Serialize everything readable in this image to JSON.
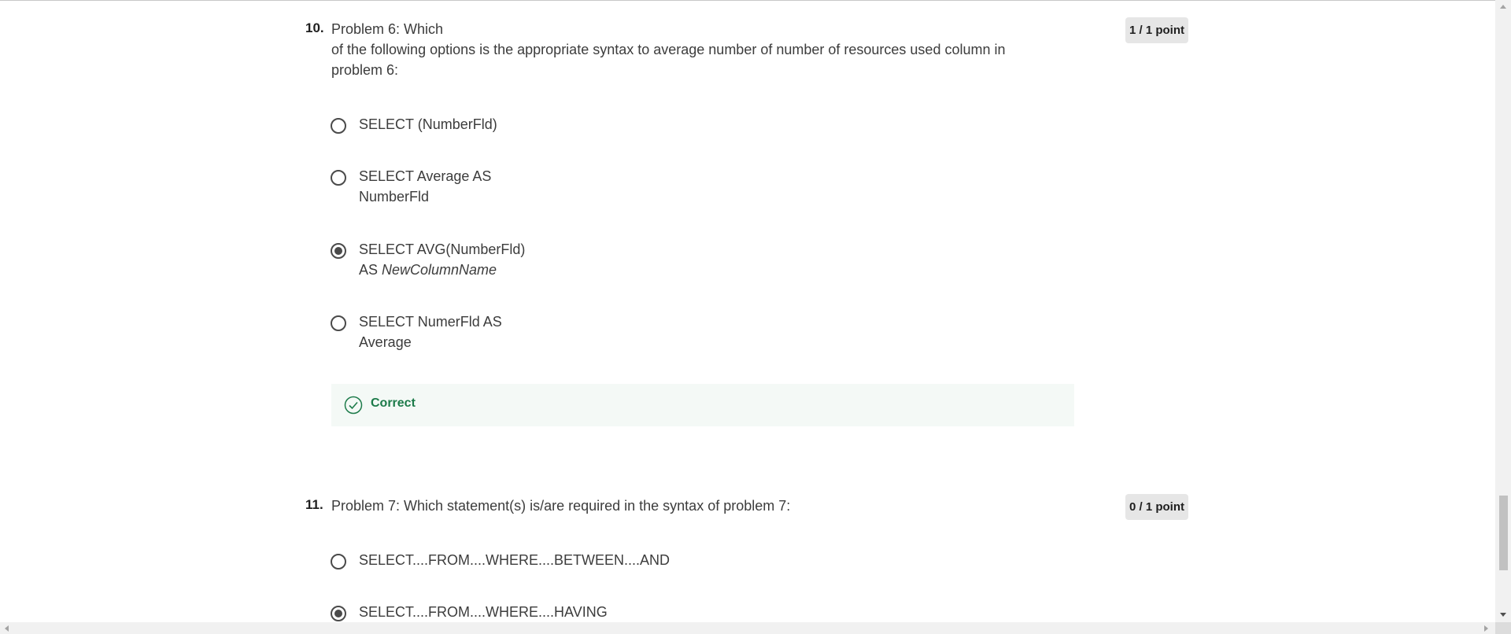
{
  "questions": [
    {
      "number": "10.",
      "text_lines": [
        "Problem 6: Which",
        "of the following options is the appropriate syntax to average number of number of resources used column in",
        "problem 6:"
      ],
      "points": "1 / 1 point",
      "options": [
        {
          "lines": [
            "SELECT (NumberFld)"
          ],
          "selected": false
        },
        {
          "lines": [
            "SELECT Average AS",
            "NumberFld"
          ],
          "selected": false
        },
        {
          "line1": "SELECT AVG(NumberFld)",
          "line2_prefix": "AS ",
          "line2_em": "NewColumnName",
          "selected": true
        },
        {
          "lines": [
            "SELECT NumerFld AS",
            "Average"
          ],
          "selected": false
        }
      ],
      "feedback": {
        "icon": "check-circle-icon",
        "label": "Correct",
        "color": "#1d7b4a"
      }
    },
    {
      "number": "11.",
      "text_lines": [
        "Problem 7: Which statement(s) is/are required in the syntax of problem 7:"
      ],
      "points": "0 / 1 point",
      "options": [
        {
          "lines": [
            "SELECT....FROM....WHERE....BETWEEN....AND"
          ],
          "selected": false
        },
        {
          "lines": [
            "SELECT....FROM....WHERE....HAVING"
          ],
          "selected": true
        }
      ]
    }
  ],
  "colors": {
    "text": "#3c3c3c",
    "badge_bg": "#e6e6e6",
    "feedback_bg": "#f4f9f6",
    "correct": "#1d7b4a"
  }
}
